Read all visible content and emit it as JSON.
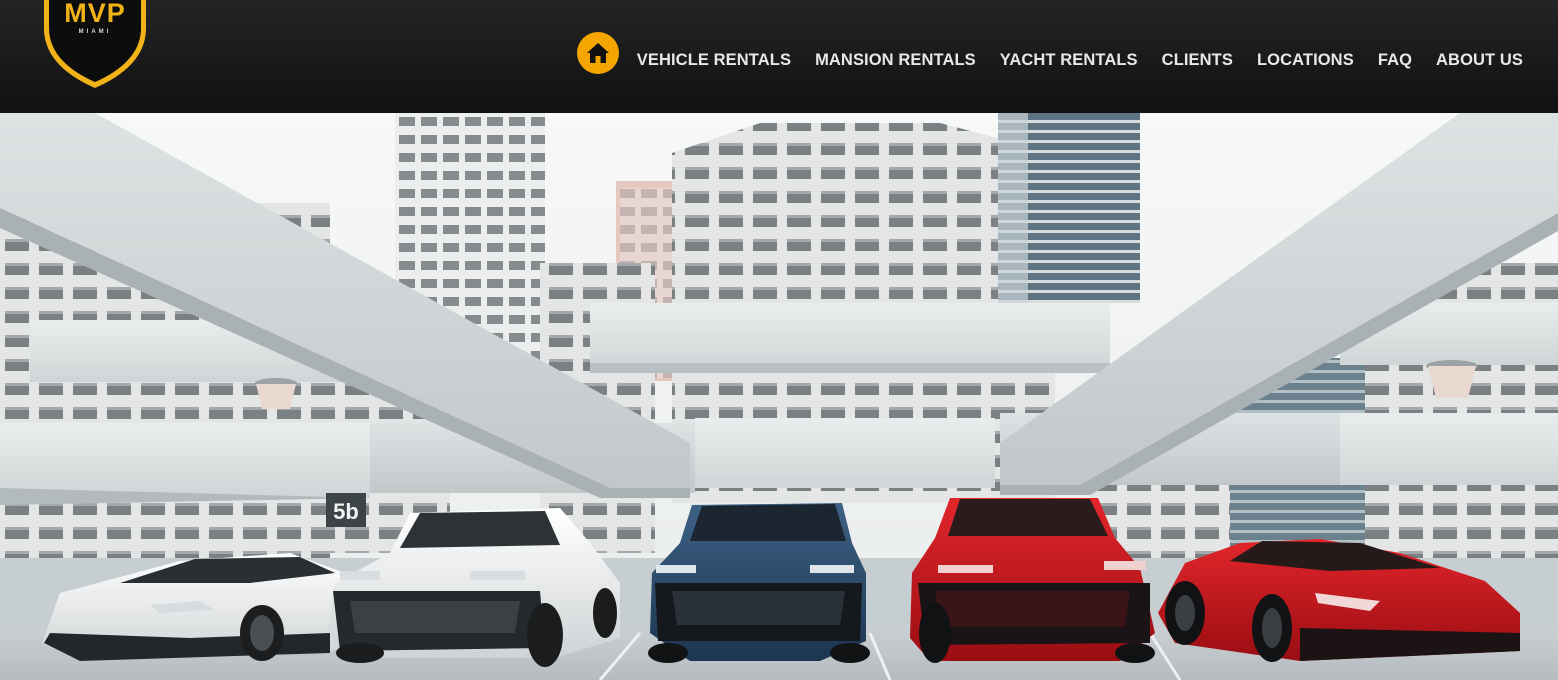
{
  "brand": {
    "logo_text": "MVP",
    "logo_subtext": "MIAMI",
    "gold": "#f2b318",
    "header_bg": "#1a1a1a"
  },
  "nav": {
    "home_icon": "home-icon",
    "home_color": "#f5a500",
    "items": [
      {
        "label": "VEHICLE RENTALS"
      },
      {
        "label": "MANSION RENTALS"
      },
      {
        "label": "YACHT RENTALS"
      },
      {
        "label": "CLIENTS"
      },
      {
        "label": "LOCATIONS"
      },
      {
        "label": "FAQ"
      },
      {
        "label": "ABOUT US"
      }
    ]
  },
  "hero": {
    "level_sign": "5b",
    "cars": [
      {
        "name": "white-coupe",
        "color": "#f2f3f4"
      },
      {
        "name": "white-suv",
        "color": "#eceeef"
      },
      {
        "name": "blue-suv",
        "color": "#2c4a6a"
      },
      {
        "name": "red-suv",
        "color": "#c0131b"
      },
      {
        "name": "red-coupe",
        "color": "#d1141b"
      }
    ]
  }
}
